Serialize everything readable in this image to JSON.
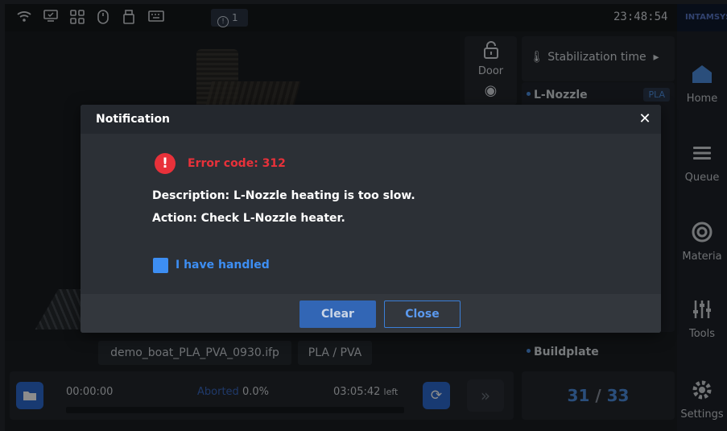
{
  "status_bar": {
    "icons": [
      "wifi-icon",
      "monitor-icon",
      "network-icon",
      "mouse-icon",
      "usb-icon",
      "keyboard-icon"
    ],
    "alert_count": "1",
    "clock": "23:48:54",
    "brand": "INTAMSYS"
  },
  "sidebar": {
    "items": [
      {
        "label": "Home",
        "icon": "home-icon"
      },
      {
        "label": "Queue",
        "icon": "queue-icon"
      },
      {
        "label": "Materia",
        "icon": "material-icon"
      },
      {
        "label": "Tools",
        "icon": "tools-icon"
      },
      {
        "label": "Settings",
        "icon": "gear-icon"
      }
    ]
  },
  "door": {
    "label": "Door"
  },
  "right_panel": {
    "stabilization": "Stabilization time",
    "nozzle_label": "L-Nozzle",
    "nozzle_material": "PLA",
    "buildplate_label": "Buildplate",
    "layer_current": "31",
    "layer_sep": "/",
    "layer_total": "33"
  },
  "job": {
    "file_name": "demo_boat_PLA_PVA_0930.ifp",
    "materials": "PLA / PVA",
    "elapsed": "00:00:00",
    "status_word": "Aborted",
    "status_percent": "0.0%",
    "remaining": "03:05:42",
    "remaining_suffix": "left",
    "progress_fraction": 0.0
  },
  "notification": {
    "title": "Notification",
    "error_code": "Error code: 312",
    "description": "Description: L-Nozzle heating is too slow.",
    "action": "Action: Check L-Nozzle heater.",
    "checkbox_label": "I have handled",
    "checkbox_checked": true,
    "clear_button": "Clear",
    "close_button": "Close"
  },
  "colors": {
    "accent": "#2d6bd0",
    "error": "#e8313a",
    "link": "#3d8ef3"
  }
}
